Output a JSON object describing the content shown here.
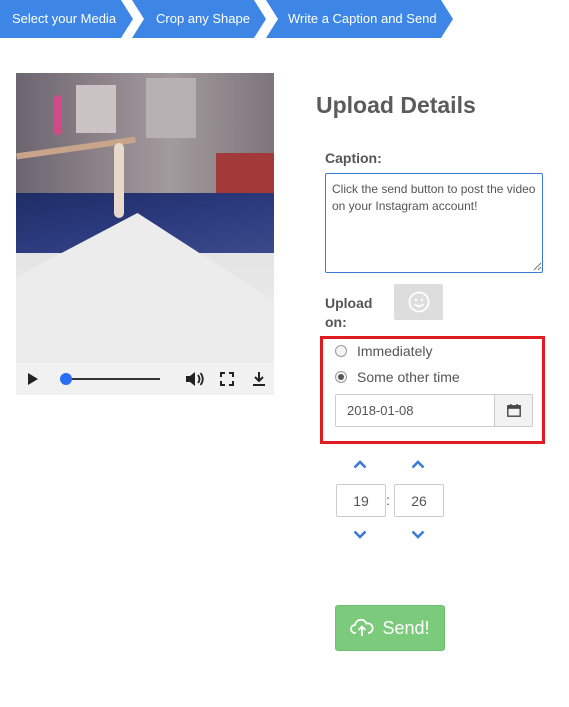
{
  "steps": [
    {
      "label": "Select your Media"
    },
    {
      "label": "Crop any Shape"
    },
    {
      "label": "Write a Caption and Send"
    }
  ],
  "video": {
    "icons": [
      "play-icon",
      "volume-icon",
      "fullscreen-icon",
      "download-icon"
    ],
    "seek_position": 0
  },
  "form": {
    "title": "Upload Details",
    "caption_label": "Caption:",
    "caption_value": "Click the send button to post the video on your Instagram account!",
    "upload_label": "Upload on:",
    "emoji_icon": "smiley-icon",
    "options": {
      "immediately": "Immediately",
      "other": "Some other time",
      "selected": "other"
    },
    "date_value": "2018-01-08",
    "time": {
      "hour": "19",
      "minute": "26",
      "separator": ":"
    },
    "send_label": "Send!",
    "send_icon": "cloud-upload-icon"
  },
  "colors": {
    "step_blue": "#3e86e6",
    "highlight_red": "#e11b22",
    "send_green": "#7cca7c",
    "accent_blue": "#2a6df4"
  }
}
